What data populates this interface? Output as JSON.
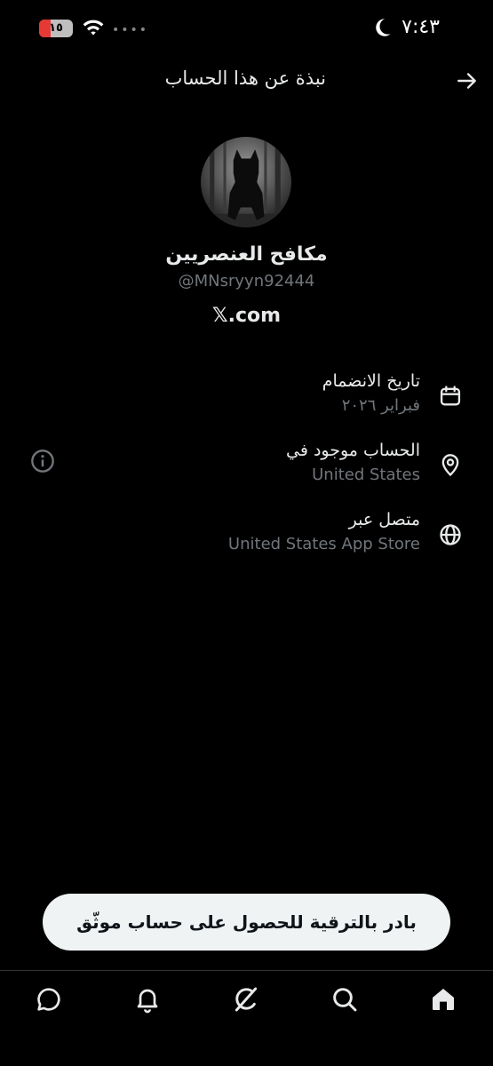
{
  "status_bar": {
    "time": "٧:٤٣",
    "battery_level": "١٥",
    "battery_fraction": 0.15
  },
  "header": {
    "title": "نبذة عن هذا الحساب"
  },
  "profile": {
    "display_name": "مكافح العنصريين",
    "handle": "@MNsryyn92444",
    "platform": "𝕏.com"
  },
  "details": [
    {
      "label": "تاريخ الانضمام",
      "value": "فبراير ٢٠٢٦",
      "icon": "calendar-icon"
    },
    {
      "label": "الحساب موجود في",
      "value": "United States",
      "icon": "location-pin-icon"
    },
    {
      "label": "متصل عبر",
      "value": "United States App Store",
      "icon": "globe-icon"
    }
  ],
  "upgrade": {
    "label": "بادر بالترقية للحصول على حساب موثّق"
  },
  "nav": [
    "home-icon",
    "search-icon",
    "grok-icon",
    "notifications-icon",
    "messages-icon"
  ],
  "colors": {
    "background": "#000000",
    "primary_text": "#e7e9ea",
    "secondary_text": "#71767b",
    "button_bg": "#eff3f4",
    "battery_low": "#e53935"
  }
}
